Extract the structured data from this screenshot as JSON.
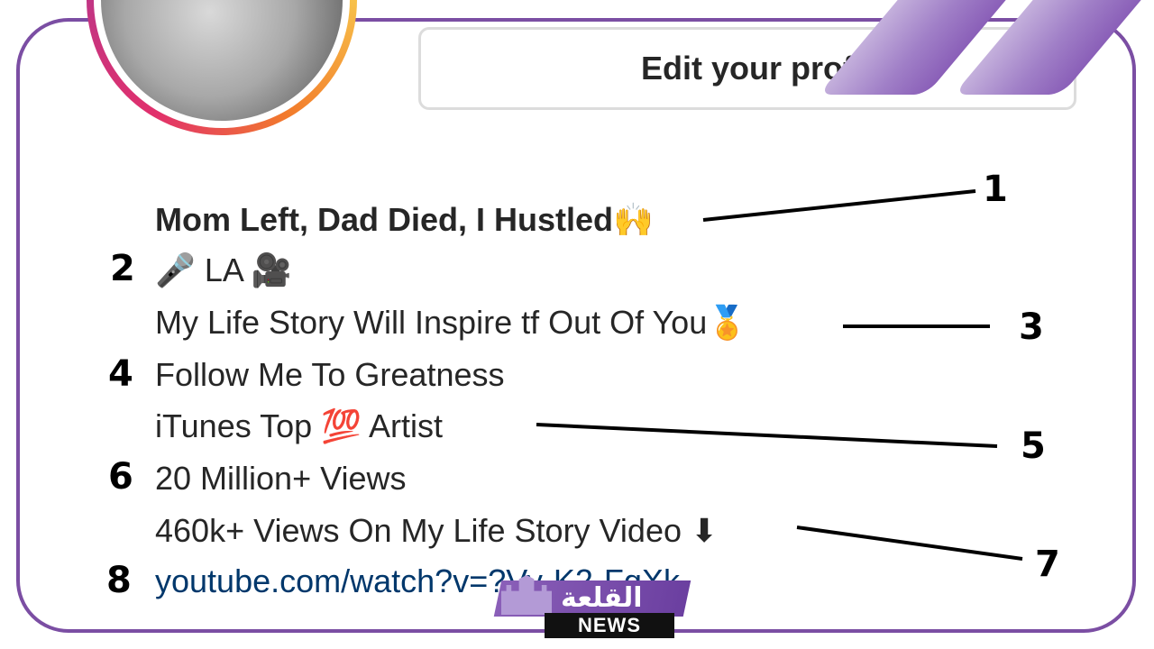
{
  "profile": {
    "edit_button": "Edit your prof",
    "bio": {
      "name_line": "Mom Left, Dad Died, I Hustled🙌",
      "line2": "🎤 LA 🎥",
      "line3": "My Life Story Will Inspire tf Out Of You🏅",
      "line4": "Follow Me To Greatness",
      "line5": "iTunes Top 💯 Artist",
      "line6": "20 Million+ Views",
      "line7": "460k+ Views On My Life Story Video ⬇",
      "link": "youtube.com/watch?v=?Vy-K2-FqXk"
    }
  },
  "annotations": {
    "n1": "1",
    "n2": "2",
    "n3": "3",
    "n4": "4",
    "n5": "5",
    "n6": "6",
    "n7": "7",
    "n8": "8"
  },
  "watermark": {
    "arabic": "القلعة",
    "news": "NEWS"
  },
  "colors": {
    "frame": "#7b4ea3",
    "link": "#00376b",
    "text": "#262626"
  }
}
